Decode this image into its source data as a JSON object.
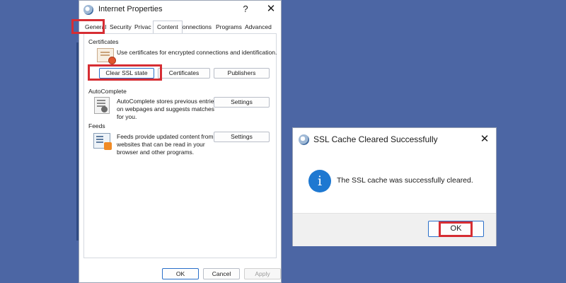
{
  "internet_properties": {
    "title": "Internet Properties",
    "help": "?",
    "close": "✕",
    "tabs": [
      "General",
      "Security",
      "Privacy",
      "Content",
      "Connections",
      "Programs",
      "Advanced"
    ],
    "active_tab": "Content",
    "certificates": {
      "title": "Certificates",
      "description": "Use certificates for encrypted connections and identification.",
      "buttons": [
        "Clear SSL state",
        "Certificates",
        "Publishers"
      ]
    },
    "autocomplete": {
      "title": "AutoComplete",
      "description": [
        "AutoComplete stores previous entries",
        "on webpages and suggests matches",
        "for you."
      ],
      "button": "Settings"
    },
    "feeds": {
      "title": "Feeds",
      "description": [
        "Feeds provide updated content from",
        "websites that can be read in your",
        "browser and other programs."
      ],
      "button": "Settings"
    },
    "footer": {
      "ok": "OK",
      "cancel": "Cancel",
      "apply": "Apply"
    }
  },
  "ssl_dialog": {
    "title": "SSL Cache Cleared Successfully",
    "close": "✕",
    "icon_letter": "i",
    "message": "The SSL cache was successfully cleared.",
    "ok": "OK"
  },
  "colors": {
    "background": "#4c66a4",
    "highlight": "#d62d33",
    "info_blue": "#1e78d1"
  }
}
